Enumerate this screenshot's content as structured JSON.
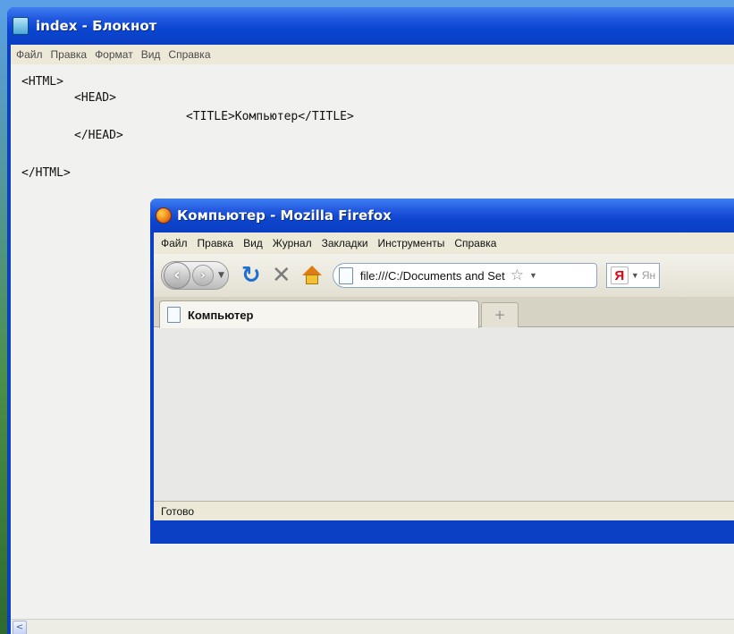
{
  "notepad": {
    "title": "index - Блокнот",
    "menu": [
      "Файл",
      "Правка",
      "Формат",
      "Вид",
      "Справка"
    ],
    "lines": {
      "html_open": "<HTML>",
      "head_open": "<HEAD>",
      "title_tag": "<TITLE>Компьютер</TITLE>",
      "head_close": "</HEAD>",
      "html_close": "</HTML>"
    },
    "scroll_left": "<"
  },
  "firefox": {
    "title": "Компьютер - Mozilla Firefox",
    "menu": [
      "Файл",
      "Правка",
      "Вид",
      "Журнал",
      "Закладки",
      "Инструменты",
      "Справка"
    ],
    "url": "file:///C:/Documents and Set",
    "search_engine": "Я",
    "search_placeholder": "Ян",
    "tab_title": "Компьютер",
    "new_tab_symbol": "+",
    "status": "Готово"
  },
  "colors": {
    "xp_title_blue": "#0b3fc4",
    "chrome_beige": "#ece9d8"
  }
}
